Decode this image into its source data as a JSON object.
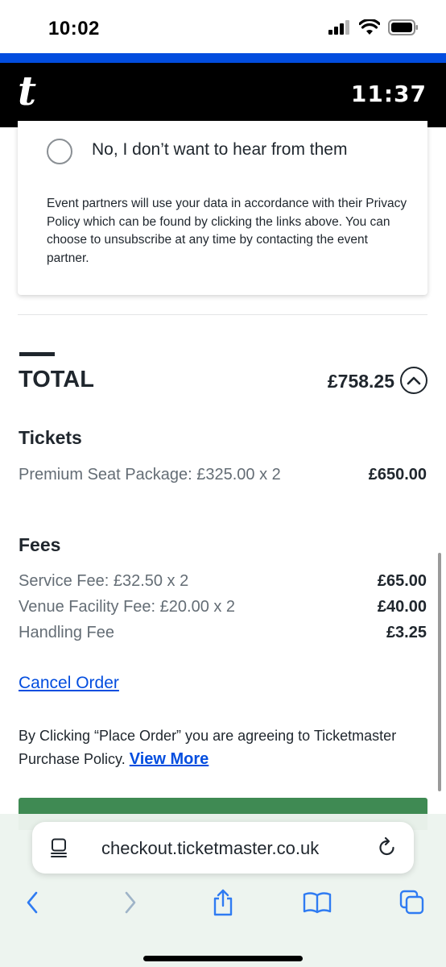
{
  "status_bar": {
    "time": "10:02"
  },
  "header": {
    "logo": "t",
    "timer": "11:37"
  },
  "consent": {
    "option_no": "No, I don’t want to hear from them",
    "note": "Event partners will use your data in accordance with their Privacy Policy which can be found by clicking the links above. You can choose to unsubscribe at any time by contacting the event partner."
  },
  "total": {
    "label": "TOTAL",
    "amount": "£758.25"
  },
  "tickets": {
    "title": "Tickets",
    "items": [
      {
        "label": "Premium Seat Package: £325.00 x 2",
        "amount": "£650.00"
      }
    ]
  },
  "fees": {
    "title": "Fees",
    "items": [
      {
        "label": "Service Fee: £32.50 x 2",
        "amount": "£65.00"
      },
      {
        "label": "Venue Facility Fee: £20.00 x 2",
        "amount": "£40.00"
      },
      {
        "label": "Handling Fee",
        "amount": "£3.25"
      }
    ]
  },
  "cancel_link": "Cancel Order",
  "policy": {
    "text": "By Clicking “Place Order” you are agreeing to Ticketmaster Purchase Policy.",
    "link": "View More"
  },
  "safari": {
    "url": "checkout.ticketmaster.co.uk"
  },
  "colors": {
    "brand_blue": "#024ddf",
    "header_black": "#000000",
    "place_order_green": "#3f8a53",
    "link_blue": "#024ddf"
  }
}
